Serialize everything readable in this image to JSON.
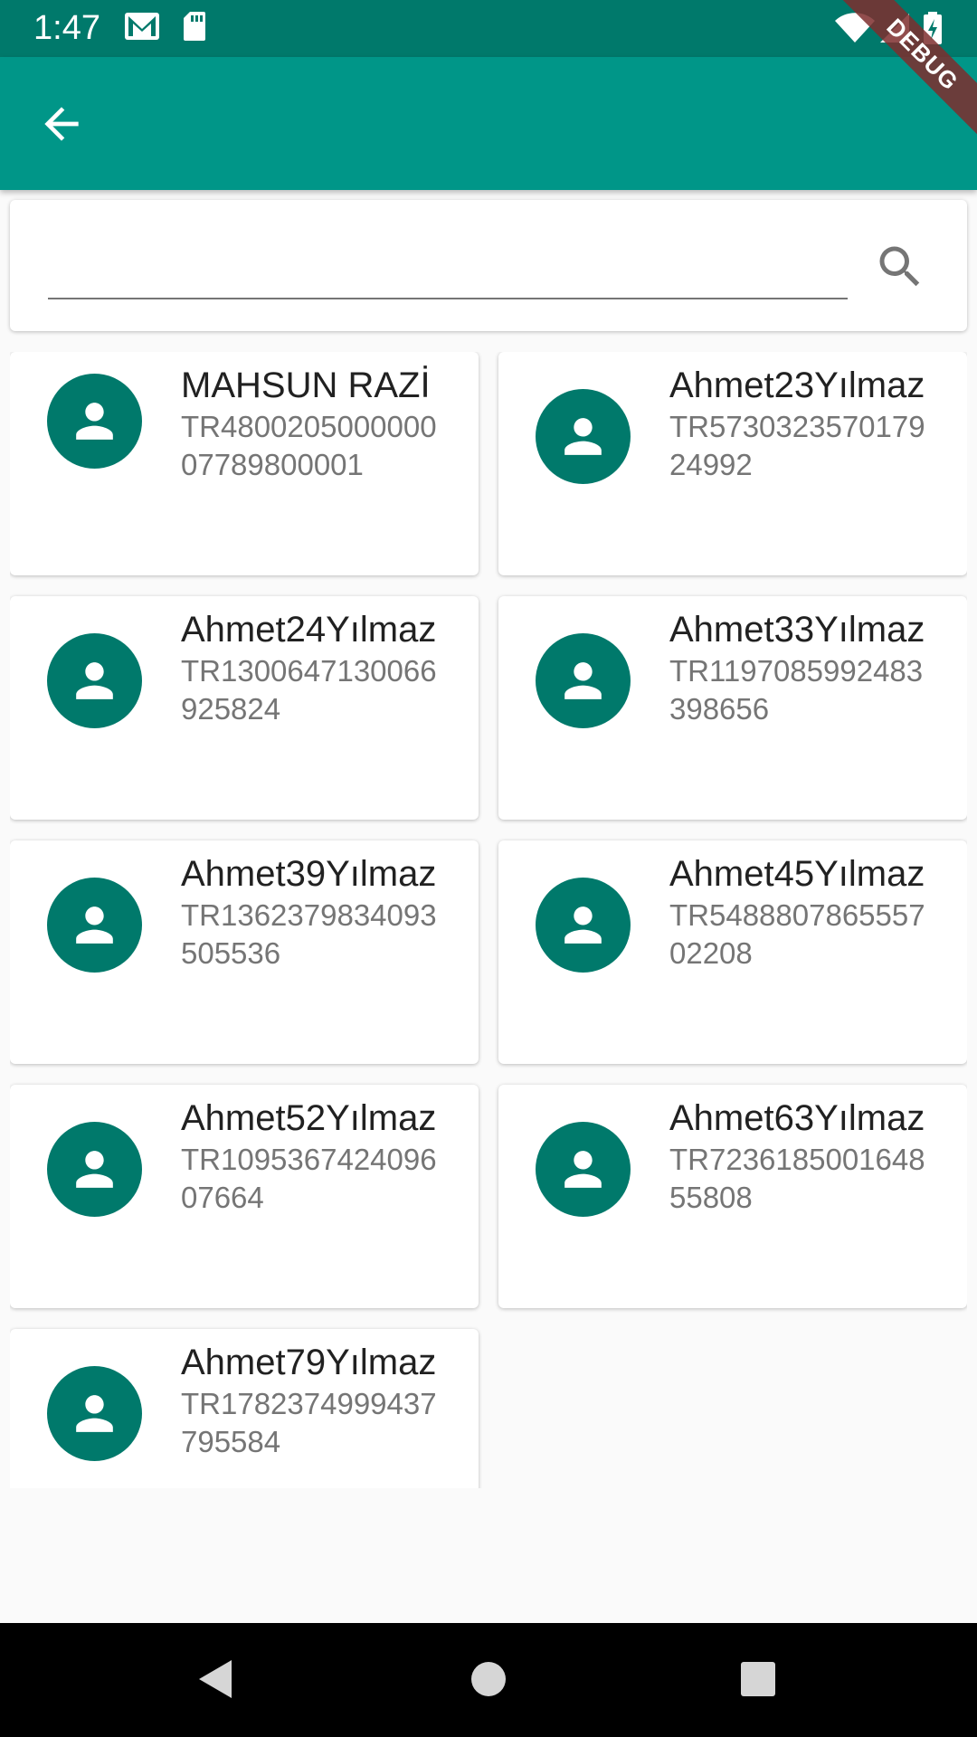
{
  "status_bar": {
    "time": "1:47"
  },
  "debug_banner": {
    "label": "DEBUG"
  },
  "search": {
    "value": ""
  },
  "contacts": [
    {
      "name": "MAHSUN RAZİ",
      "iban": "TR480020500000007789800001"
    },
    {
      "name": "Ahmet23Yılmaz",
      "iban": "TR573032357017924992"
    },
    {
      "name": "Ahmet24Yılmaz",
      "iban": "TR1300647130066925824"
    },
    {
      "name": "Ahmet33Yılmaz",
      "iban": "TR1197085992483398656"
    },
    {
      "name": "Ahmet39Yılmaz",
      "iban": "TR1362379834093505536"
    },
    {
      "name": "Ahmet45Yılmaz",
      "iban": "TR548880786555702208"
    },
    {
      "name": "Ahmet52Yılmaz",
      "iban": "TR109536742409607664"
    },
    {
      "name": "Ahmet63Yılmaz",
      "iban": "TR723618500164855808"
    },
    {
      "name": "Ahmet79Yılmaz",
      "iban": "TR1782374999437795584"
    }
  ],
  "colors": {
    "primary": "#009688",
    "primary_dark": "#00796b",
    "background": "#fafafa"
  },
  "icons": {
    "back": "arrow-back-icon",
    "search": "search-icon",
    "avatar": "person-icon",
    "nav_back": "triangle-back-icon",
    "nav_home": "circle-home-icon",
    "nav_recents": "square-recents-icon"
  }
}
